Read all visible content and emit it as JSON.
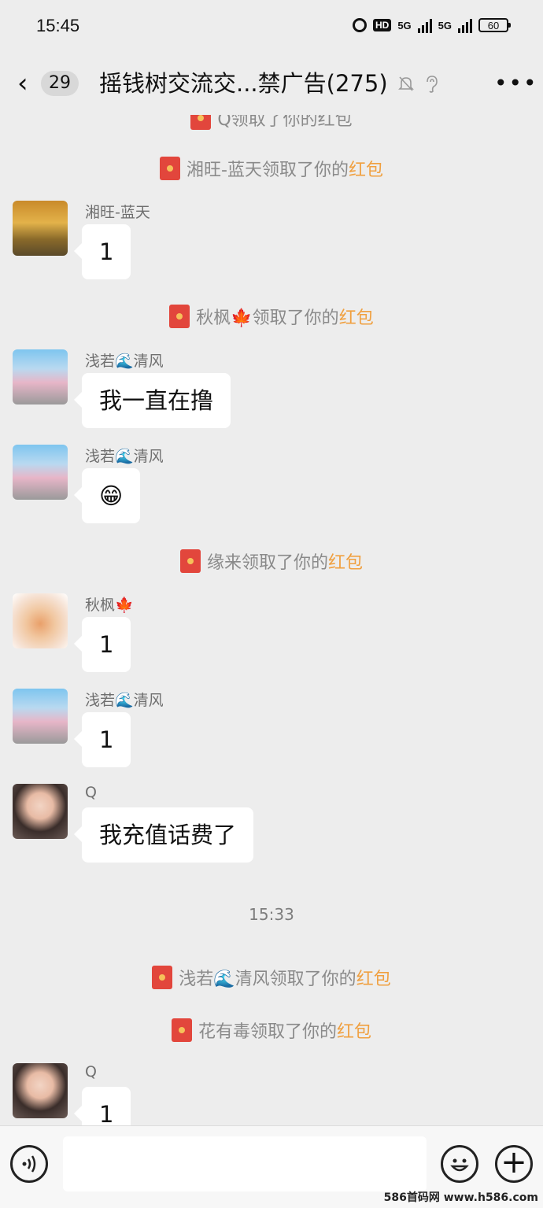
{
  "status": {
    "time": "15:45",
    "hd": "HD",
    "net1": "5G",
    "net2": "5G",
    "battery": "60"
  },
  "header": {
    "back_count": "29",
    "title": "摇钱树交流交...禁广告(275)"
  },
  "chat": {
    "top_partial": "Q领取了你的红包",
    "events": [
      {
        "who": "湘旺-蓝天领取了你的",
        "link": "红包"
      },
      {
        "who": "秋枫🍁领取了你的",
        "link": "红包"
      },
      {
        "who": "缘来领取了你的",
        "link": "红包"
      },
      {
        "who": "浅若🌊清风领取了你的",
        "link": "红包"
      },
      {
        "who": "花有毒领取了你的",
        "link": "红包"
      }
    ],
    "time_divider": "15:33",
    "messages": [
      {
        "sender": "湘旺-蓝天",
        "text": "1"
      },
      {
        "sender": "浅若🌊清风",
        "text": "我一直在撸"
      },
      {
        "sender": "浅若🌊清风",
        "text": "😁"
      },
      {
        "sender": "秋枫🍁",
        "text": "1"
      },
      {
        "sender": "浅若🌊清风",
        "text": "1"
      },
      {
        "sender": "Q",
        "text": "我充值话费了"
      },
      {
        "sender": "Q",
        "text": "1"
      }
    ]
  },
  "watermark": "586首码网 www.h586.com",
  "colors": {
    "background": "#ededed",
    "red_packet": "#e2463c",
    "link": "#f0a040",
    "bubble": "#ffffff"
  }
}
